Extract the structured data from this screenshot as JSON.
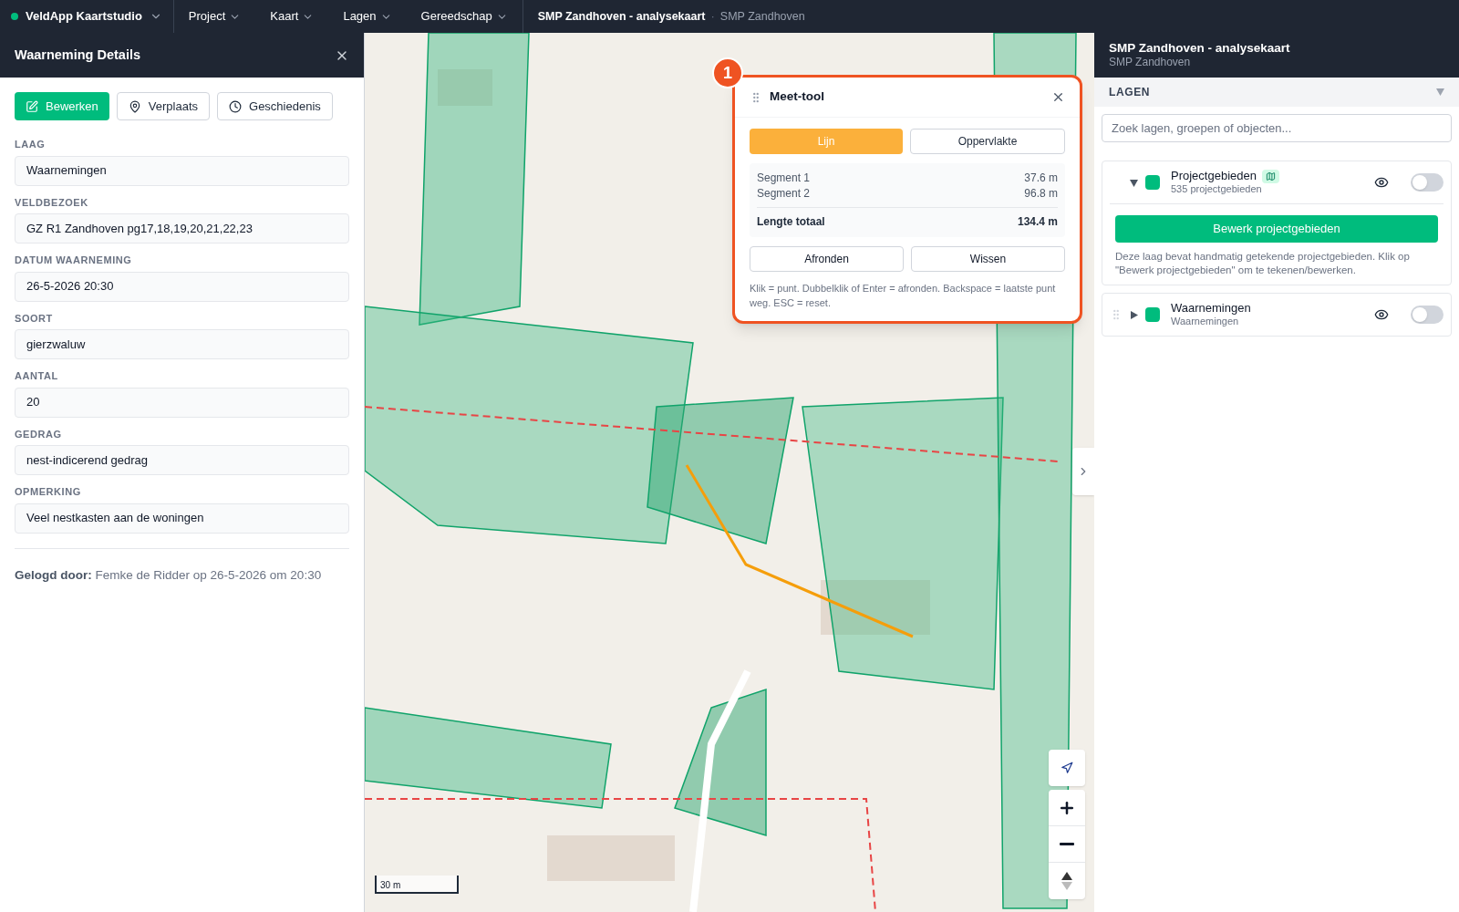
{
  "app": {
    "name": "VeldApp Kaartstudio"
  },
  "menu": [
    {
      "label": "Project"
    },
    {
      "label": "Kaart"
    },
    {
      "label": "Lagen"
    },
    {
      "label": "Gereedschap"
    }
  ],
  "breadcrumb": {
    "title": "SMP Zandhoven - analysekaart",
    "separator": "·",
    "subtitle": "SMP Zandhoven"
  },
  "details_panel": {
    "title": "Waarneming Details",
    "actions": [
      {
        "label": "Bewerken",
        "kind": "edit",
        "primary": true
      },
      {
        "label": "Verplaats",
        "kind": "move",
        "primary": false
      },
      {
        "label": "Geschiedenis",
        "kind": "history",
        "primary": false
      }
    ],
    "fields": [
      {
        "label": "LAAG",
        "value": "Waarnemingen"
      },
      {
        "label": "VELDBEZOEK",
        "value": "GZ R1 Zandhoven pg17,18,19,20,21,22,23"
      },
      {
        "label": "DATUM WAARNEMING",
        "value": "26-5-2026 20:30"
      },
      {
        "label": "SOORT",
        "value": "gierzwaluw"
      },
      {
        "label": "AANTAL",
        "value": "20"
      },
      {
        "label": "GEDRAG",
        "value": "nest-indicerend gedrag"
      },
      {
        "label": "OPMERKING",
        "value": "Veel nestkasten aan de woningen"
      }
    ],
    "footer": "**Gelogd door:** Femke de Ridder op 26-5-2026 om 20:30"
  },
  "map": {
    "scale": "30 m",
    "measure_tool": {
      "badge": "1",
      "title": "Meet-tool",
      "modes": [
        {
          "label": "Lijn",
          "selected": true
        },
        {
          "label": "Oppervlakte",
          "selected": false
        }
      ],
      "segments": [
        {
          "label": "Segment 1",
          "value": "37.6 m"
        },
        {
          "label": "Segment 2",
          "value": "96.8 m"
        }
      ],
      "total": {
        "label": "Lengte totaal",
        "value": "134.4 m"
      },
      "buttons": [
        "Afronden",
        "Wissen"
      ],
      "hint": "Klik = punt. Dubbelklik of Enter = afronden. Backspace = laatste punt weg. ESC = reset."
    }
  },
  "layers_panel": {
    "title": "SMP Zandhoven - analysekaart",
    "subtitle": "SMP Zandhoven",
    "section": "LAGEN",
    "expanded": true,
    "search": {
      "placeholder": "Zoek lagen, groepen of objecten..."
    },
    "layers": [
      {
        "name": "Projectgebieden",
        "count": "535 projectgebieden",
        "drawn": true,
        "expanded": true,
        "on": false,
        "action": "Bewerk projectgebieden",
        "description": "Deze laag bevat handmatig getekende projectgebieden. Klik op \"Bewerk projectgebieden\" om te tekenen/bewerken."
      },
      {
        "name": "Waarnemingen",
        "count": "Waarnemingen",
        "drawn": false,
        "expanded": false,
        "on": false
      }
    ]
  }
}
